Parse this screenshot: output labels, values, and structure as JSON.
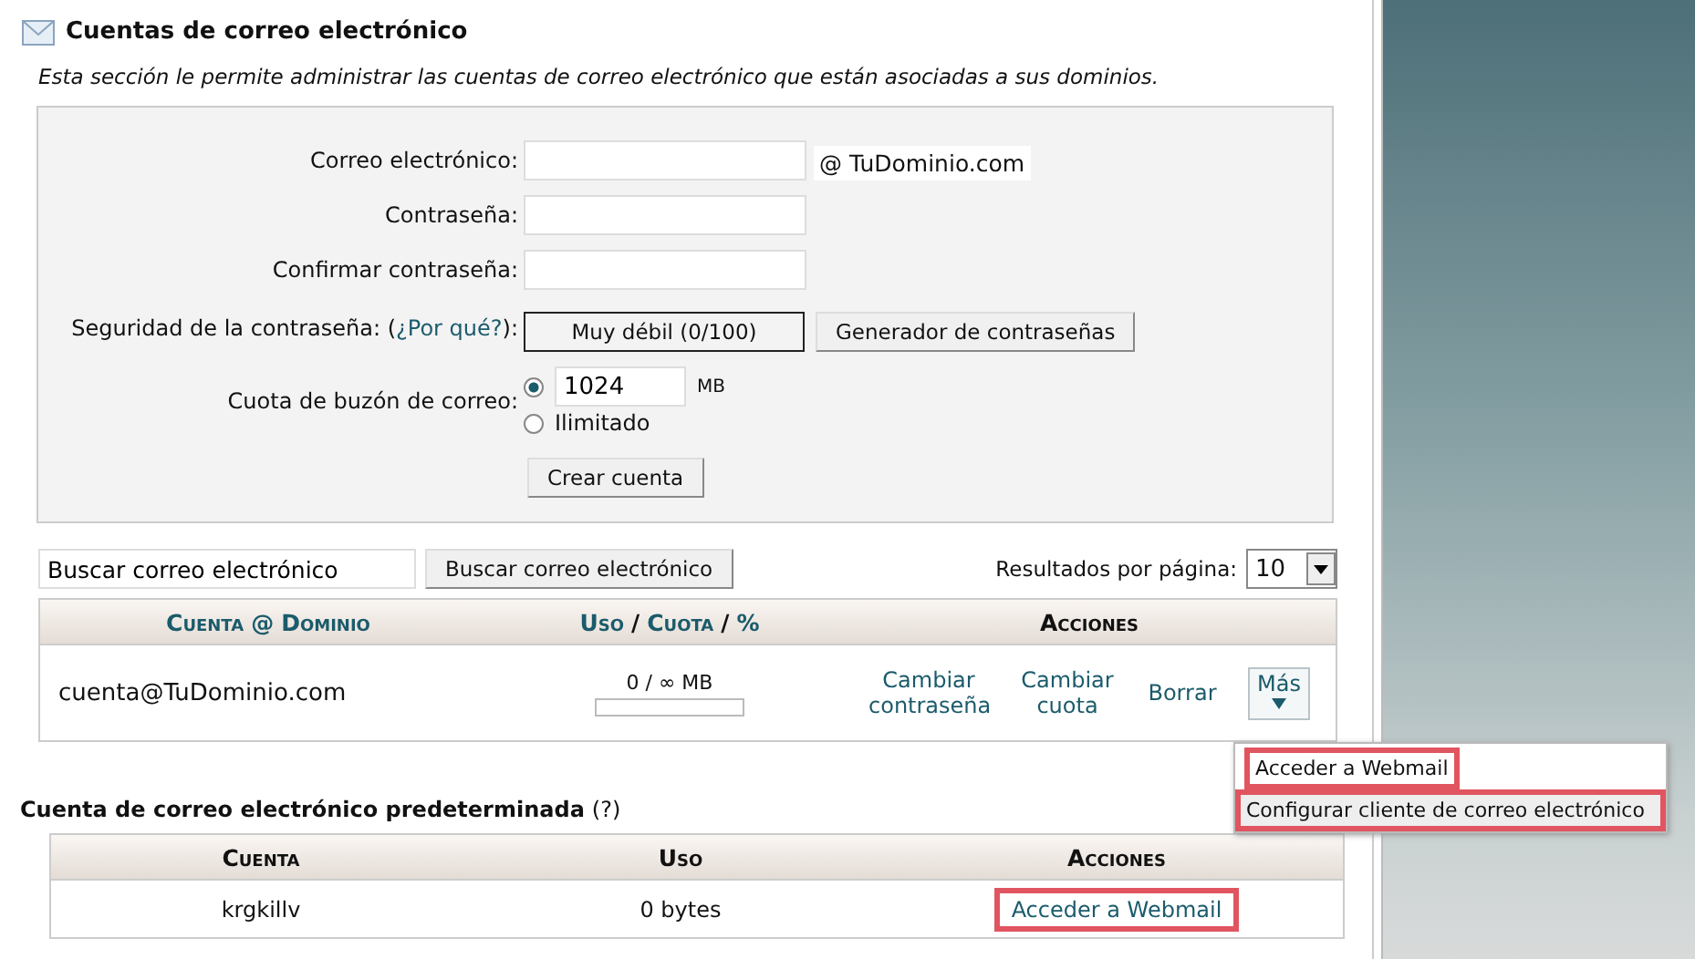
{
  "section": {
    "title": "Cuentas de correo electrónico",
    "description": "Esta sección le permite administrar las cuentas de correo electrónico que están asociadas a sus dominios."
  },
  "form": {
    "fields": [
      {
        "label": "Correo electrónico:",
        "suffix": "@ TuDominio.com"
      },
      {
        "label": "Contraseña:"
      },
      {
        "label": "Confirmar contraseña:"
      }
    ],
    "strength": {
      "label_before": "Seguridad de la contraseña: (",
      "link": "¿Por qué?",
      "label_after": "):",
      "meter": "Muy débil (0/100)",
      "generator_button": "Generador de contraseñas"
    },
    "quota": {
      "label": "Cuota de buzón de correo:",
      "options": [
        {
          "kind": "amount",
          "value": "1024",
          "unit": "MB",
          "selected": true
        },
        {
          "kind": "unlimited",
          "label": "Ilimitado",
          "selected": false
        }
      ]
    },
    "submit": "Crear cuenta"
  },
  "search": {
    "value": "Buscar correo electrónico",
    "button": "Buscar correo electrónico",
    "per_page_label": "Resultados por página:",
    "per_page": "10"
  },
  "accounts": {
    "columns": [
      [
        {
          "text": "Cuenta",
          "sortable": true
        },
        {
          "text": "@",
          "sortable": true
        },
        {
          "text": "Dominio",
          "sortable": true
        }
      ],
      [
        {
          "text": "Uso",
          "sortable": true
        },
        {
          "text": "/",
          "sortable": false
        },
        {
          "text": "Cuota",
          "sortable": true
        },
        {
          "text": "/",
          "sortable": false
        },
        {
          "text": "%",
          "sortable": true
        }
      ],
      [
        {
          "text": "Acciones",
          "sortable": false
        }
      ]
    ],
    "rows": [
      {
        "account": "cuenta@TuDominio.com",
        "usage": "0 / ∞ MB",
        "actions": [
          "Cambiar contraseña",
          "Cambiar cuota",
          "Borrar"
        ],
        "more": {
          "label": "Más",
          "expanded": true,
          "items": [
            {
              "label": "Acceder a Webmail",
              "highlighted": true,
              "selected": false
            },
            {
              "label": "Configurar cliente de correo electrónico",
              "highlighted": true,
              "selected": true
            }
          ]
        }
      }
    ]
  },
  "default_account": {
    "title": "Cuenta de correo electrónico predeterminada",
    "help": "(?)",
    "columns": [
      "Cuenta",
      "Uso",
      "Acciones"
    ],
    "rows": [
      {
        "account": "krgkillv",
        "usage": "0 bytes",
        "action": "Acceder a Webmail",
        "highlighted": true
      }
    ]
  }
}
